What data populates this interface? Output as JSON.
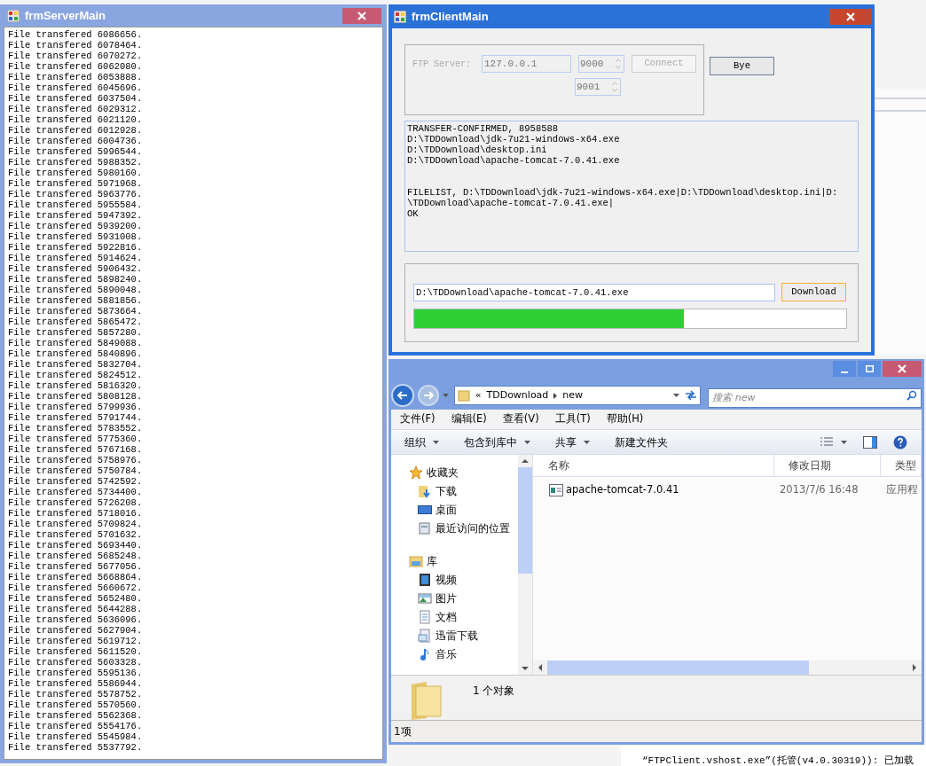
{
  "server_window": {
    "title": "frmServerMain",
    "active": false,
    "log": [
      "File transfered 6086656.",
      "File transfered 6078464.",
      "File transfered 6070272.",
      "File transfered 6062080.",
      "File transfered 6053888.",
      "File transfered 6045696.",
      "File transfered 6037504.",
      "File transfered 6029312.",
      "File transfered 6021120.",
      "File transfered 6012928.",
      "File transfered 6004736.",
      "File transfered 5996544.",
      "File transfered 5988352.",
      "File transfered 5980160.",
      "File transfered 5971968.",
      "File transfered 5963776.",
      "File transfered 5955584.",
      "File transfered 5947392.",
      "File transfered 5939200.",
      "File transfered 5931008.",
      "File transfered 5922816.",
      "File transfered 5914624.",
      "File transfered 5906432.",
      "File transfered 5898240.",
      "File transfered 5890048.",
      "File transfered 5881856.",
      "File transfered 5873664.",
      "File transfered 5865472.",
      "File transfered 5857280.",
      "File transfered 5849088.",
      "File transfered 5840896.",
      "File transfered 5832704.",
      "File transfered 5824512.",
      "File transfered 5816320.",
      "File transfered 5808128.",
      "File transfered 5799936.",
      "File transfered 5791744.",
      "File transfered 5783552.",
      "File transfered 5775360.",
      "File transfered 5767168.",
      "File transfered 5758976.",
      "File transfered 5750784.",
      "File transfered 5742592.",
      "File transfered 5734400.",
      "File transfered 5726208.",
      "File transfered 5718016.",
      "File transfered 5709824.",
      "File transfered 5701632.",
      "File transfered 5693440.",
      "File transfered 5685248.",
      "File transfered 5677056.",
      "File transfered 5668864.",
      "File transfered 5660672.",
      "File transfered 5652480.",
      "File transfered 5644288.",
      "File transfered 5636096.",
      "File transfered 5627904.",
      "File transfered 5619712.",
      "File transfered 5611520.",
      "File transfered 5603328.",
      "File transfered 5595136.",
      "File transfered 5586944.",
      "File transfered 5578752.",
      "File transfered 5570560.",
      "File transfered 5562368.",
      "File transfered 5554176.",
      "File transfered 5545984.",
      "File transfered 5537792."
    ]
  },
  "client_window": {
    "title": "frmClientMain",
    "active": true,
    "server_group": {
      "disabled": true,
      "label": "FTP Server:",
      "address": "127.0.0.1",
      "ports": [
        "9000",
        "9001"
      ],
      "connect": "Connect"
    },
    "bye": "Bye",
    "output_blocks": [
      [
        "TRANSFER-CONFIRMED, 8958588",
        "D:\\TDDownload\\jdk-7u21-windows-x64.exe",
        "D:\\TDDownload\\desktop.ini",
        "D:\\TDDownload\\apache-tomcat-7.0.41.exe"
      ],
      [
        "FILELIST, D:\\TDDownload\\jdk-7u21-windows-x64.exe|D:\\TDDownload\\desktop.ini|D:",
        "\\TDDownload\\apache-tomcat-7.0.41.exe|",
        "OK"
      ]
    ],
    "file_path": "D:\\TDDownload\\apache-tomcat-7.0.41.exe",
    "download": "Download",
    "progress": {
      "level": 0.625
    }
  },
  "explorer": {
    "active": false,
    "breadcrumb_overflow": "«",
    "breadcrumb": [
      "TDDownload",
      "new"
    ],
    "search_placeholder": "搜索 new",
    "menu": [
      "文件(F)",
      "编辑(E)",
      "查看(V)",
      "工具(T)",
      "帮助(H)"
    ],
    "toolbar": [
      {
        "label": "组织",
        "dropdown": true
      },
      {
        "label": "包含到库中",
        "dropdown": true
      },
      {
        "label": "共享",
        "dropdown": true
      },
      {
        "label": "新建文件夹",
        "dropdown": false
      }
    ],
    "nav": [
      {
        "label": "收藏夹",
        "kind": "favorites",
        "children": [
          {
            "label": "下载",
            "kind": "downloads"
          },
          {
            "label": "桌面",
            "kind": "desktop"
          },
          {
            "label": "最近访问的位置",
            "kind": "recent"
          }
        ]
      },
      {
        "label": "库",
        "kind": "library",
        "children": [
          {
            "label": "视频",
            "kind": "video"
          },
          {
            "label": "图片",
            "kind": "pictures"
          },
          {
            "label": "文档",
            "kind": "documents"
          },
          {
            "label": "迅雷下载",
            "kind": "docfolder"
          },
          {
            "label": "音乐",
            "kind": "music"
          }
        ]
      }
    ],
    "columns": [
      "名称",
      "修改日期",
      "类型"
    ],
    "rows": [
      {
        "name": "apache-tomcat-7.0.41",
        "modified": "2013/7/6 16:48",
        "type": "应用程",
        "selected": false
      }
    ],
    "details": "1 个对象",
    "status": "1项"
  },
  "background": {
    "output_line": "“FTPClient.vshost.exe”(托管(v4.0.30319)): 已加载"
  }
}
